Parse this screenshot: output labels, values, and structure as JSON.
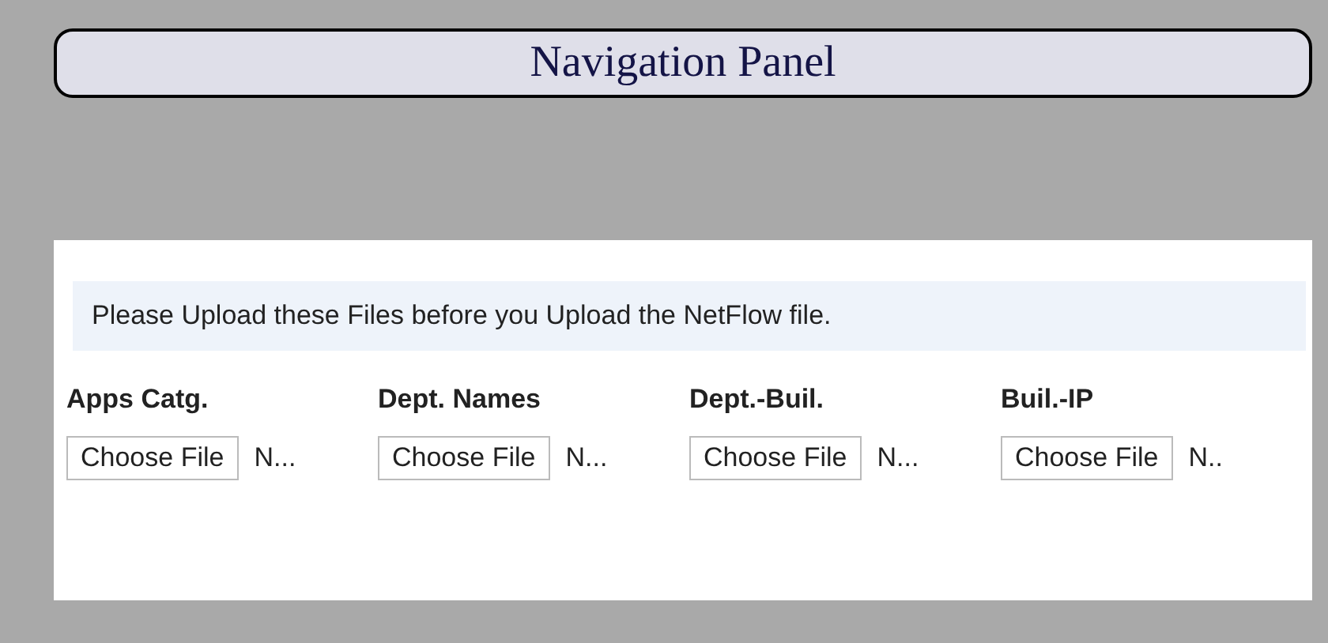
{
  "header": {
    "title": "Navigation Panel"
  },
  "upload_panel": {
    "notice": "Please Upload these Files before you Upload the NetFlow file.",
    "files": [
      {
        "label": "Apps Catg.",
        "button": "Choose File",
        "status": "N..."
      },
      {
        "label": "Dept. Names",
        "button": "Choose File",
        "status": "N..."
      },
      {
        "label": "Dept.-Buil.",
        "button": "Choose File",
        "status": "N..."
      },
      {
        "label": "Buil.-IP",
        "button": "Choose File",
        "status": "N.."
      }
    ]
  }
}
